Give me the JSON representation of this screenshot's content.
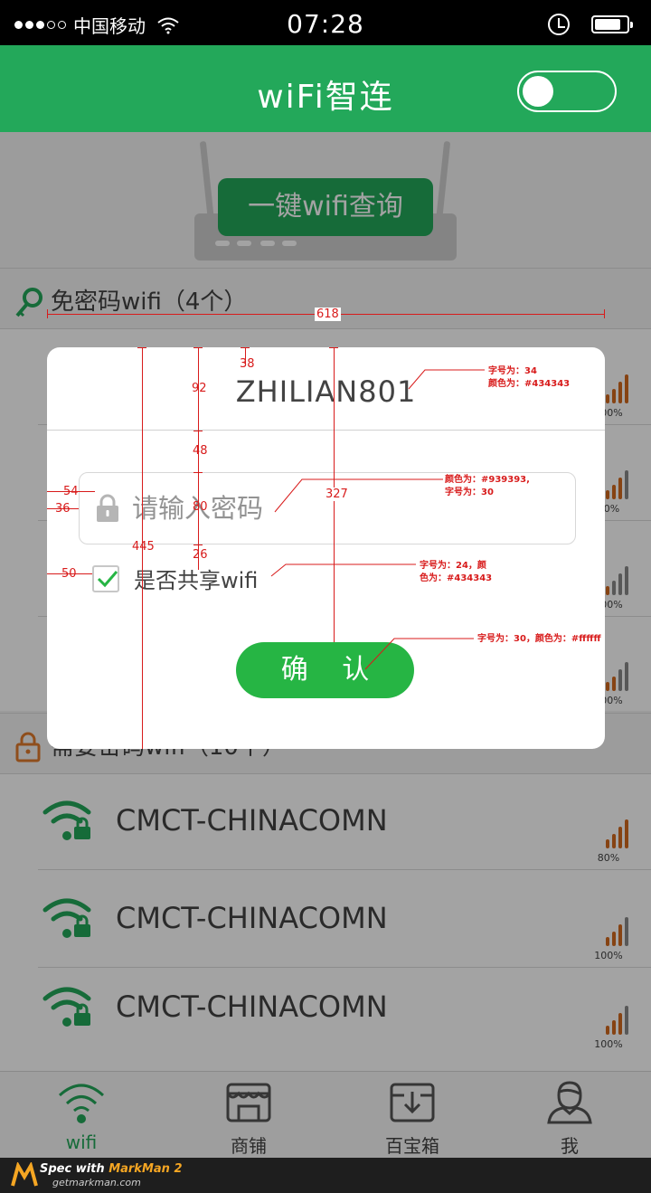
{
  "status_bar": {
    "carrier": "中国移动",
    "time": "07:28"
  },
  "header": {
    "title": "wiFi智连",
    "toggle_state": "off"
  },
  "hero": {
    "query_button": "一键wifi查询"
  },
  "free_section": {
    "label": "免密码wifi（4个）"
  },
  "locked_section": {
    "label": "需要密码wifi（10个）"
  },
  "free_rows": [
    {
      "pct": "100%",
      "level": 4
    },
    {
      "pct": "80%",
      "level": 3
    },
    {
      "pct": "100%",
      "level": 4
    },
    {
      "pct": "100%",
      "level": 4
    }
  ],
  "locked_rows": [
    {
      "ssid": "CMCT-CHINACOMN",
      "pct": "80%",
      "level": 4
    },
    {
      "ssid": "CMCT-CHINACOMN",
      "pct": "100%",
      "level": 3
    },
    {
      "ssid": "CMCT-CHINACOMN",
      "pct": "100%",
      "level": 3
    }
  ],
  "dialog": {
    "ssid": "ZHILIAN801",
    "password_placeholder": "请输入密码",
    "share_label": "是否共享wifi",
    "share_checked": true,
    "confirm_label": "确 认"
  },
  "tabs": [
    {
      "label": "wifi",
      "active": true
    },
    {
      "label": "商铺",
      "active": false
    },
    {
      "label": "百宝箱",
      "active": false
    },
    {
      "label": "我",
      "active": false
    }
  ],
  "annotations": {
    "width_618": "618",
    "d92": "92",
    "d38": "38",
    "d48": "48",
    "d80": "80",
    "d26": "26",
    "d327": "327",
    "d445": "445",
    "d54": "54",
    "d36": "36",
    "d50": "50",
    "note_title": "字号为：34\n颜色为：#434343",
    "note_input": "颜色为：#939393,\n字号为：30",
    "note_share": "字号为：24，颜\n色为：#434343",
    "note_confirm": "字号为：30，颜色为：#ffffff"
  },
  "watermark": {
    "brand_prefix": "Spec with ",
    "brand_name": "MarkMan 2",
    "url": "getmarkman.com"
  },
  "colors": {
    "brand_green": "#23a85a",
    "button_green": "#26b544",
    "text_dark": "#434343",
    "placeholder": "#939393",
    "signal_orange": "#d2691e",
    "annotation_red": "#d81b1b"
  }
}
